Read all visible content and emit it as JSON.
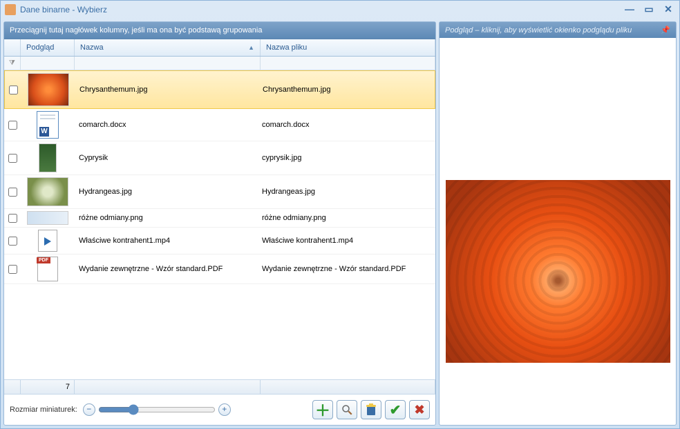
{
  "window": {
    "title": "Dane binarne - Wybierz"
  },
  "groupBar": "Przeciągnij tutaj nagłówek kolumny, jeśli ma ona być podstawą grupowania",
  "columns": {
    "thumb": "Podgląd",
    "name": "Nazwa",
    "file": "Nazwa pliku"
  },
  "rows": [
    {
      "name": "Chrysanthemum.jpg",
      "file": "Chrysanthemum.jpg",
      "thumb": "flower",
      "selected": true
    },
    {
      "name": "comarch.docx",
      "file": "comarch.docx",
      "thumb": "doc"
    },
    {
      "name": "Cyprysik",
      "file": "cyprysik.jpg",
      "thumb": "conifer"
    },
    {
      "name": "Hydrangeas.jpg",
      "file": "Hydrangeas.jpg",
      "thumb": "hydrangea"
    },
    {
      "name": "różne odmiany.png",
      "file": "różne odmiany.png",
      "thumb": "png-thumb"
    },
    {
      "name": "Właściwe kontrahent1.mp4",
      "file": "Właściwe kontrahent1.mp4",
      "thumb": "mp4"
    },
    {
      "name": "Wydanie zewnętrzne - Wzór standard.PDF",
      "file": "Wydanie zewnętrzne - Wzór standard.PDF",
      "thumb": "pdf"
    }
  ],
  "footer": {
    "count": "7"
  },
  "toolbar": {
    "sliderLabel": "Rozmiar miniaturek:"
  },
  "preview": {
    "header": "Podgląd – kliknij, aby wyświetlić okienko podglądu pliku"
  }
}
